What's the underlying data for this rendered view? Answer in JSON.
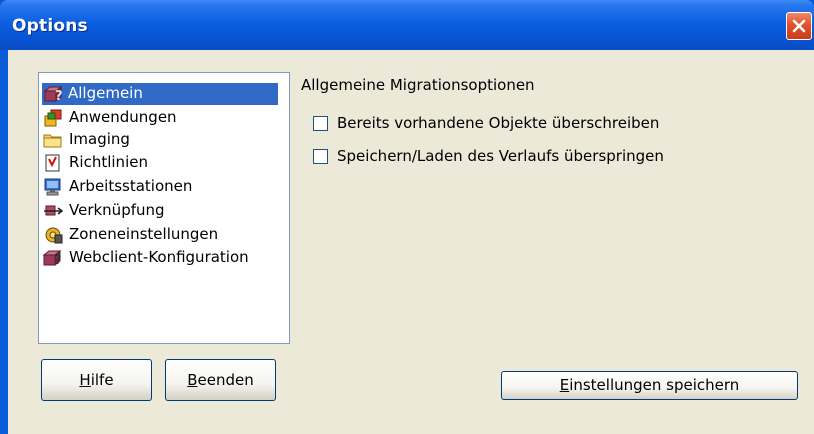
{
  "window": {
    "title": "Options"
  },
  "sidebar": {
    "items": [
      {
        "label": "Allgemein",
        "icon": "general-icon",
        "selected": true
      },
      {
        "label": "Anwendungen",
        "icon": "applications-icon",
        "selected": false
      },
      {
        "label": "Imaging",
        "icon": "folder-icon",
        "selected": false
      },
      {
        "label": "Richtlinien",
        "icon": "policy-icon",
        "selected": false
      },
      {
        "label": "Arbeitsstationen",
        "icon": "workstation-icon",
        "selected": false
      },
      {
        "label": "Verknüpfung",
        "icon": "link-icon",
        "selected": false
      },
      {
        "label": "Zoneneinstellungen",
        "icon": "zone-icon",
        "selected": false
      },
      {
        "label": "Webclient-Konfiguration",
        "icon": "webclient-icon",
        "selected": false
      }
    ]
  },
  "main": {
    "heading": "Allgemeine Migrationsoptionen",
    "options": [
      {
        "label": "Bereits vorhandene Objekte überschreiben",
        "checked": false
      },
      {
        "label": "Speichern/Laden des Verlaufs überspringen",
        "checked": false
      }
    ]
  },
  "buttons": {
    "help": {
      "mnemonic": "H",
      "rest": "ilfe"
    },
    "exit": {
      "mnemonic": "B",
      "rest": "eenden"
    },
    "save": {
      "mnemonic": "E",
      "rest": "instellungen speichern"
    }
  },
  "colors": {
    "titlebar": "#0a5bd8",
    "selection": "#316ac5",
    "dialog_bg": "#ece9d8",
    "close": "#e0512c"
  }
}
